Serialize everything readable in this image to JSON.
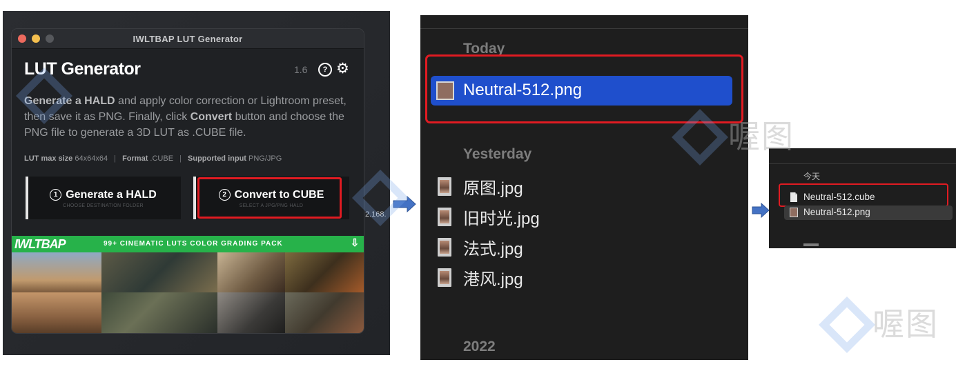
{
  "window": {
    "title": "IWLTBAP LUT Generator",
    "app_title": "LUT Generator",
    "version": "1.6",
    "description": {
      "p1": "Generate a HALD",
      "p2": " and apply color correction or Lightroom preset, then save it as PNG. Finally, click ",
      "p3": "Convert",
      "p4": " button and choose the PNG file to generate a 3D LUT as .CUBE file."
    },
    "specs": {
      "size_label": "LUT max size",
      "size_value": "64x64x64",
      "format_label": "Format",
      "format_value": ".CUBE",
      "input_label": "Supported input",
      "input_value": "PNG/JPG"
    },
    "buttons": {
      "generate": {
        "number": "1",
        "label": "Generate a HALD",
        "sublabel": "CHOOSE DESTINATION FOLDER"
      },
      "convert": {
        "number": "2",
        "label": "Convert to CUBE",
        "sublabel": "SELECT A JPG/PNG HALD"
      }
    },
    "promo": {
      "logo": "IWLTBAP",
      "text": "99+ CINEMATIC LUTS COLOR GRADING PACK"
    },
    "ip_fragment": "2.168."
  },
  "finder_large": {
    "groups": {
      "today": "Today",
      "yesterday": "Yesterday",
      "year": "2022"
    },
    "selected_file": "Neutral-512.png",
    "files": [
      "原图.jpg",
      "旧时光.jpg",
      "法式.jpg",
      "港风.jpg"
    ]
  },
  "finder_small": {
    "group": "今天",
    "files": [
      "Neutral-512.cube",
      "Neutral-512.png"
    ]
  },
  "watermark": {
    "text": "喔图"
  },
  "colors": {
    "accent_red": "#e11b22",
    "selection_blue": "#1f4fcc",
    "promo_green": "#27b24a",
    "arrow_blue": "#4472c4"
  }
}
